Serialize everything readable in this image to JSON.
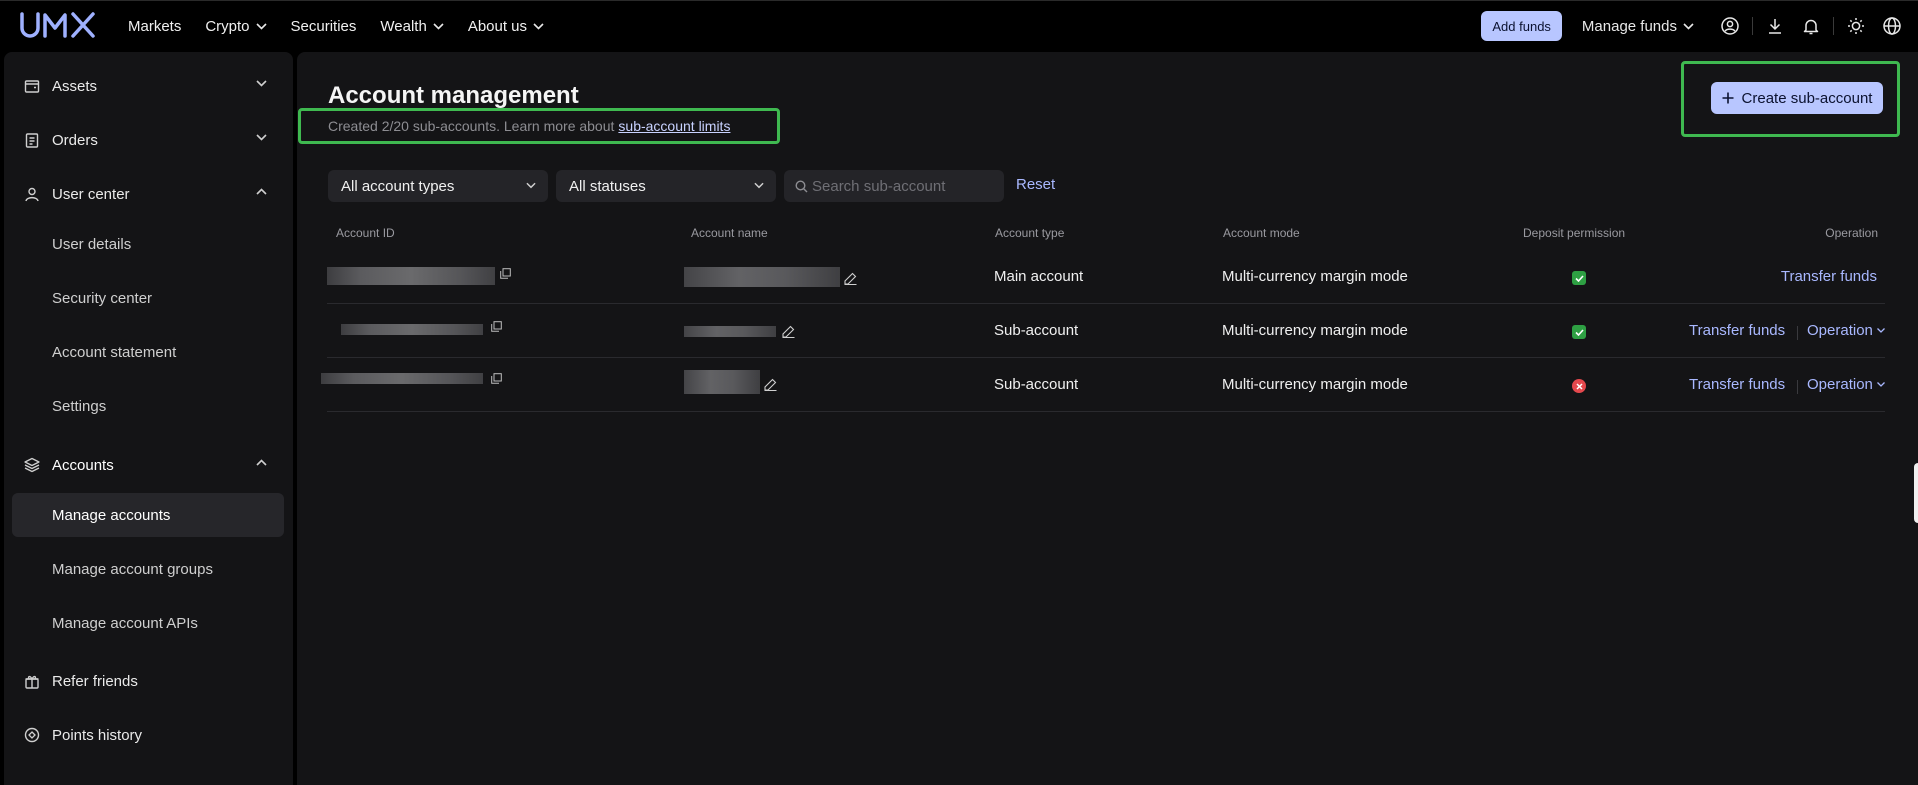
{
  "brand": {
    "logo_text": "UMX"
  },
  "nav": {
    "items": [
      {
        "label": "Markets",
        "has_dropdown": false
      },
      {
        "label": "Crypto",
        "has_dropdown": true
      },
      {
        "label": "Securities",
        "has_dropdown": false
      },
      {
        "label": "Wealth",
        "has_dropdown": true
      },
      {
        "label": "About us",
        "has_dropdown": true
      }
    ]
  },
  "topbar": {
    "add_funds_label": "Add funds",
    "manage_funds_label": "Manage funds",
    "icons": [
      "user-icon",
      "download-icon",
      "bell-icon",
      "sun-icon",
      "globe-icon"
    ]
  },
  "sidebar": {
    "groups": [
      {
        "label": "Assets",
        "icon": "wallet-icon",
        "expanded": false
      },
      {
        "label": "Orders",
        "icon": "clipboard-icon",
        "expanded": false
      },
      {
        "label": "User center",
        "icon": "user-icon",
        "expanded": true,
        "children": [
          "User details",
          "Security center",
          "Account statement",
          "Settings"
        ]
      },
      {
        "label": "Accounts",
        "icon": "layers-icon",
        "expanded": true,
        "children": [
          "Manage accounts",
          "Manage account groups",
          "Manage account APIs"
        ],
        "active_child": "Manage accounts"
      },
      {
        "label": "Refer friends",
        "icon": "gift-icon",
        "expanded": false
      },
      {
        "label": "Points history",
        "icon": "points-icon",
        "expanded": false
      }
    ]
  },
  "main": {
    "title": "Account management",
    "subtitle": "Created 2/20 sub-accounts. Learn more about",
    "subtitle_link": "sub-account limits",
    "create_button_label": "Create sub-account",
    "filters": {
      "account_type": "All account types",
      "status": "All statuses",
      "search_placeholder": "Search sub-account",
      "reset_label": "Reset"
    },
    "table": {
      "columns": [
        "Account ID",
        "Account name",
        "Account type",
        "Account mode",
        "Deposit permission",
        "Operation"
      ],
      "rows": [
        {
          "account_type": "Main account",
          "account_mode": "Multi-currency margin mode",
          "deposit_permission": "allowed",
          "transfer_label": "Transfer funds",
          "operation_label": ""
        },
        {
          "account_type": "Sub-account",
          "account_mode": "Multi-currency margin mode",
          "deposit_permission": "allowed",
          "transfer_label": "Transfer funds",
          "operation_label": "Operation"
        },
        {
          "account_type": "Sub-account",
          "account_mode": "Multi-currency margin mode",
          "deposit_permission": "denied",
          "transfer_label": "Transfer funds",
          "operation_label": "Operation"
        }
      ]
    }
  },
  "colors": {
    "accent": "#b8c6ff",
    "link": "#a9b8ff",
    "highlight": "#3fb950",
    "status_ok": "#2ea043",
    "status_denied": "#e5484d"
  }
}
